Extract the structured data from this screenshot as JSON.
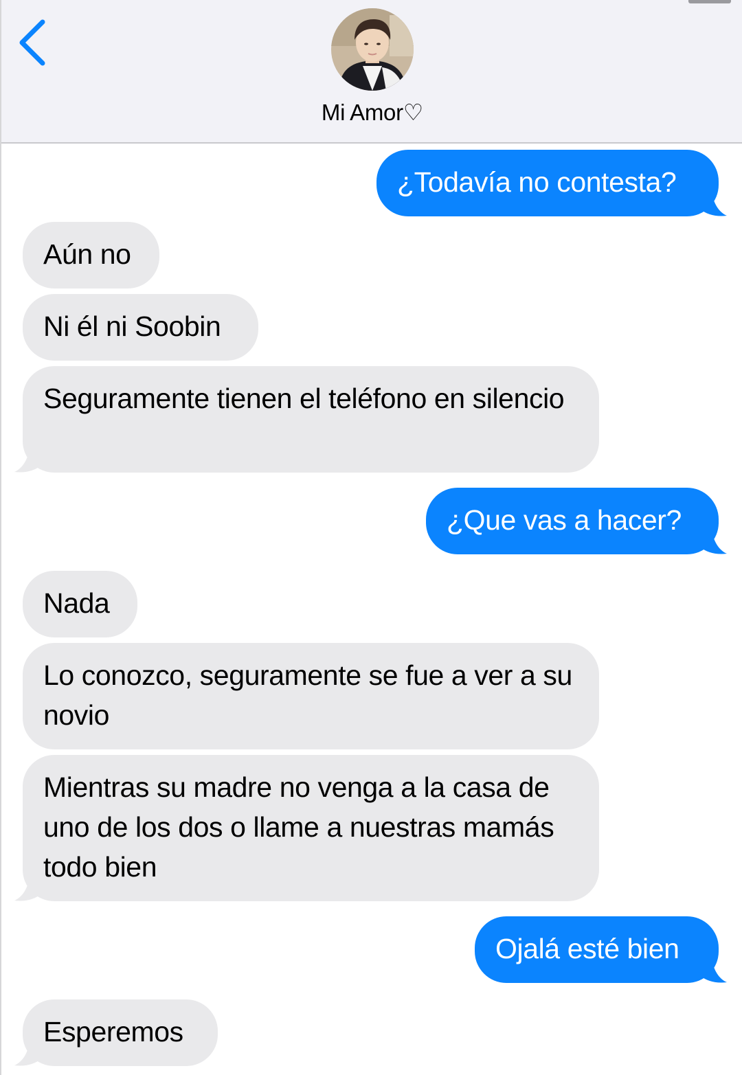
{
  "header": {
    "contact_name": "Mi Amor♡"
  },
  "colors": {
    "header_bg": "#f2f2f7",
    "accent_blue": "#0b84fe",
    "incoming_bubble": "#e9e9eb"
  },
  "messages": [
    {
      "direction": "outgoing",
      "text": "¿Todavía no contesta?"
    },
    {
      "direction": "incoming",
      "text": "Aún no"
    },
    {
      "direction": "incoming",
      "text": "Ni él ni Soobin"
    },
    {
      "direction": "incoming",
      "text": "Seguramente tienen el teléfono en silencio"
    },
    {
      "direction": "outgoing",
      "text": "¿Que vas a hacer?"
    },
    {
      "direction": "incoming",
      "text": "Nada"
    },
    {
      "direction": "incoming",
      "text": "Lo conozco, seguramente se fue a ver a su novio"
    },
    {
      "direction": "incoming",
      "text": "Mientras su madre no venga a la casa de uno de  los dos o llame a nuestras mamás todo bien"
    },
    {
      "direction": "outgoing",
      "text": "Ojalá esté bien"
    },
    {
      "direction": "incoming",
      "text": "Esperemos"
    }
  ]
}
